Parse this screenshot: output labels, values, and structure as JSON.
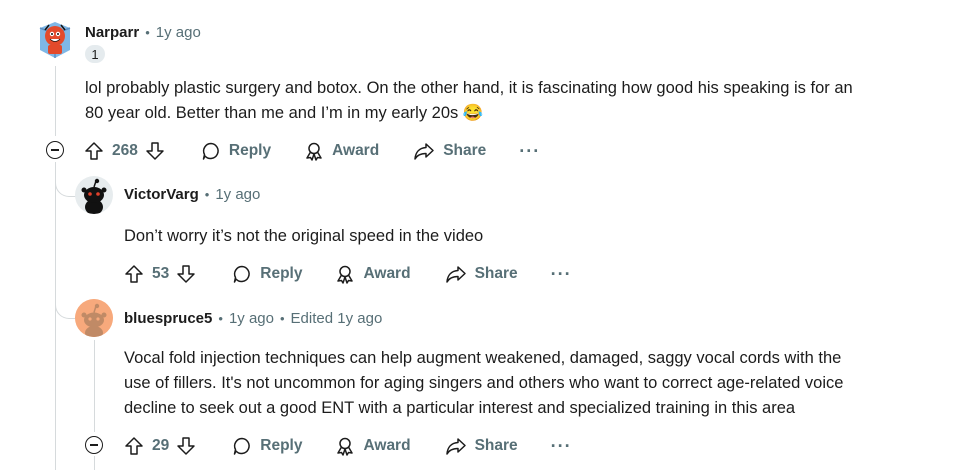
{
  "comments": [
    {
      "author": "Narparr",
      "time": "1y ago",
      "badge": "1",
      "body_line1": "lol probably plastic surgery and botox. On the other hand, it is fascinating how good his speaking is for an",
      "body_line2": "80 year old. Better than me and I’m in my early 20s 😂",
      "score": "268",
      "reply": "Reply",
      "award": "Award",
      "share": "Share",
      "more": "···"
    },
    {
      "author": "VictorVarg",
      "time": "1y ago",
      "body_line1": "Don’t worry it’s not the original speed in the video",
      "score": "53",
      "reply": "Reply",
      "award": "Award",
      "share": "Share",
      "more": "···"
    },
    {
      "author": "bluespruce5",
      "time": "1y ago",
      "edited": "Edited 1y ago",
      "body_line1": "Vocal fold injection techniques can help augment weakened, damaged, saggy vocal cords with the",
      "body_line2": "use of fillers. It's not uncommon for aging singers and others who want to correct age-related voice",
      "body_line3": "decline to seek out a good ENT with a particular interest and specialized training in this area",
      "score": "29",
      "reply": "Reply",
      "award": "Award",
      "share": "Share",
      "more": "···"
    }
  ]
}
